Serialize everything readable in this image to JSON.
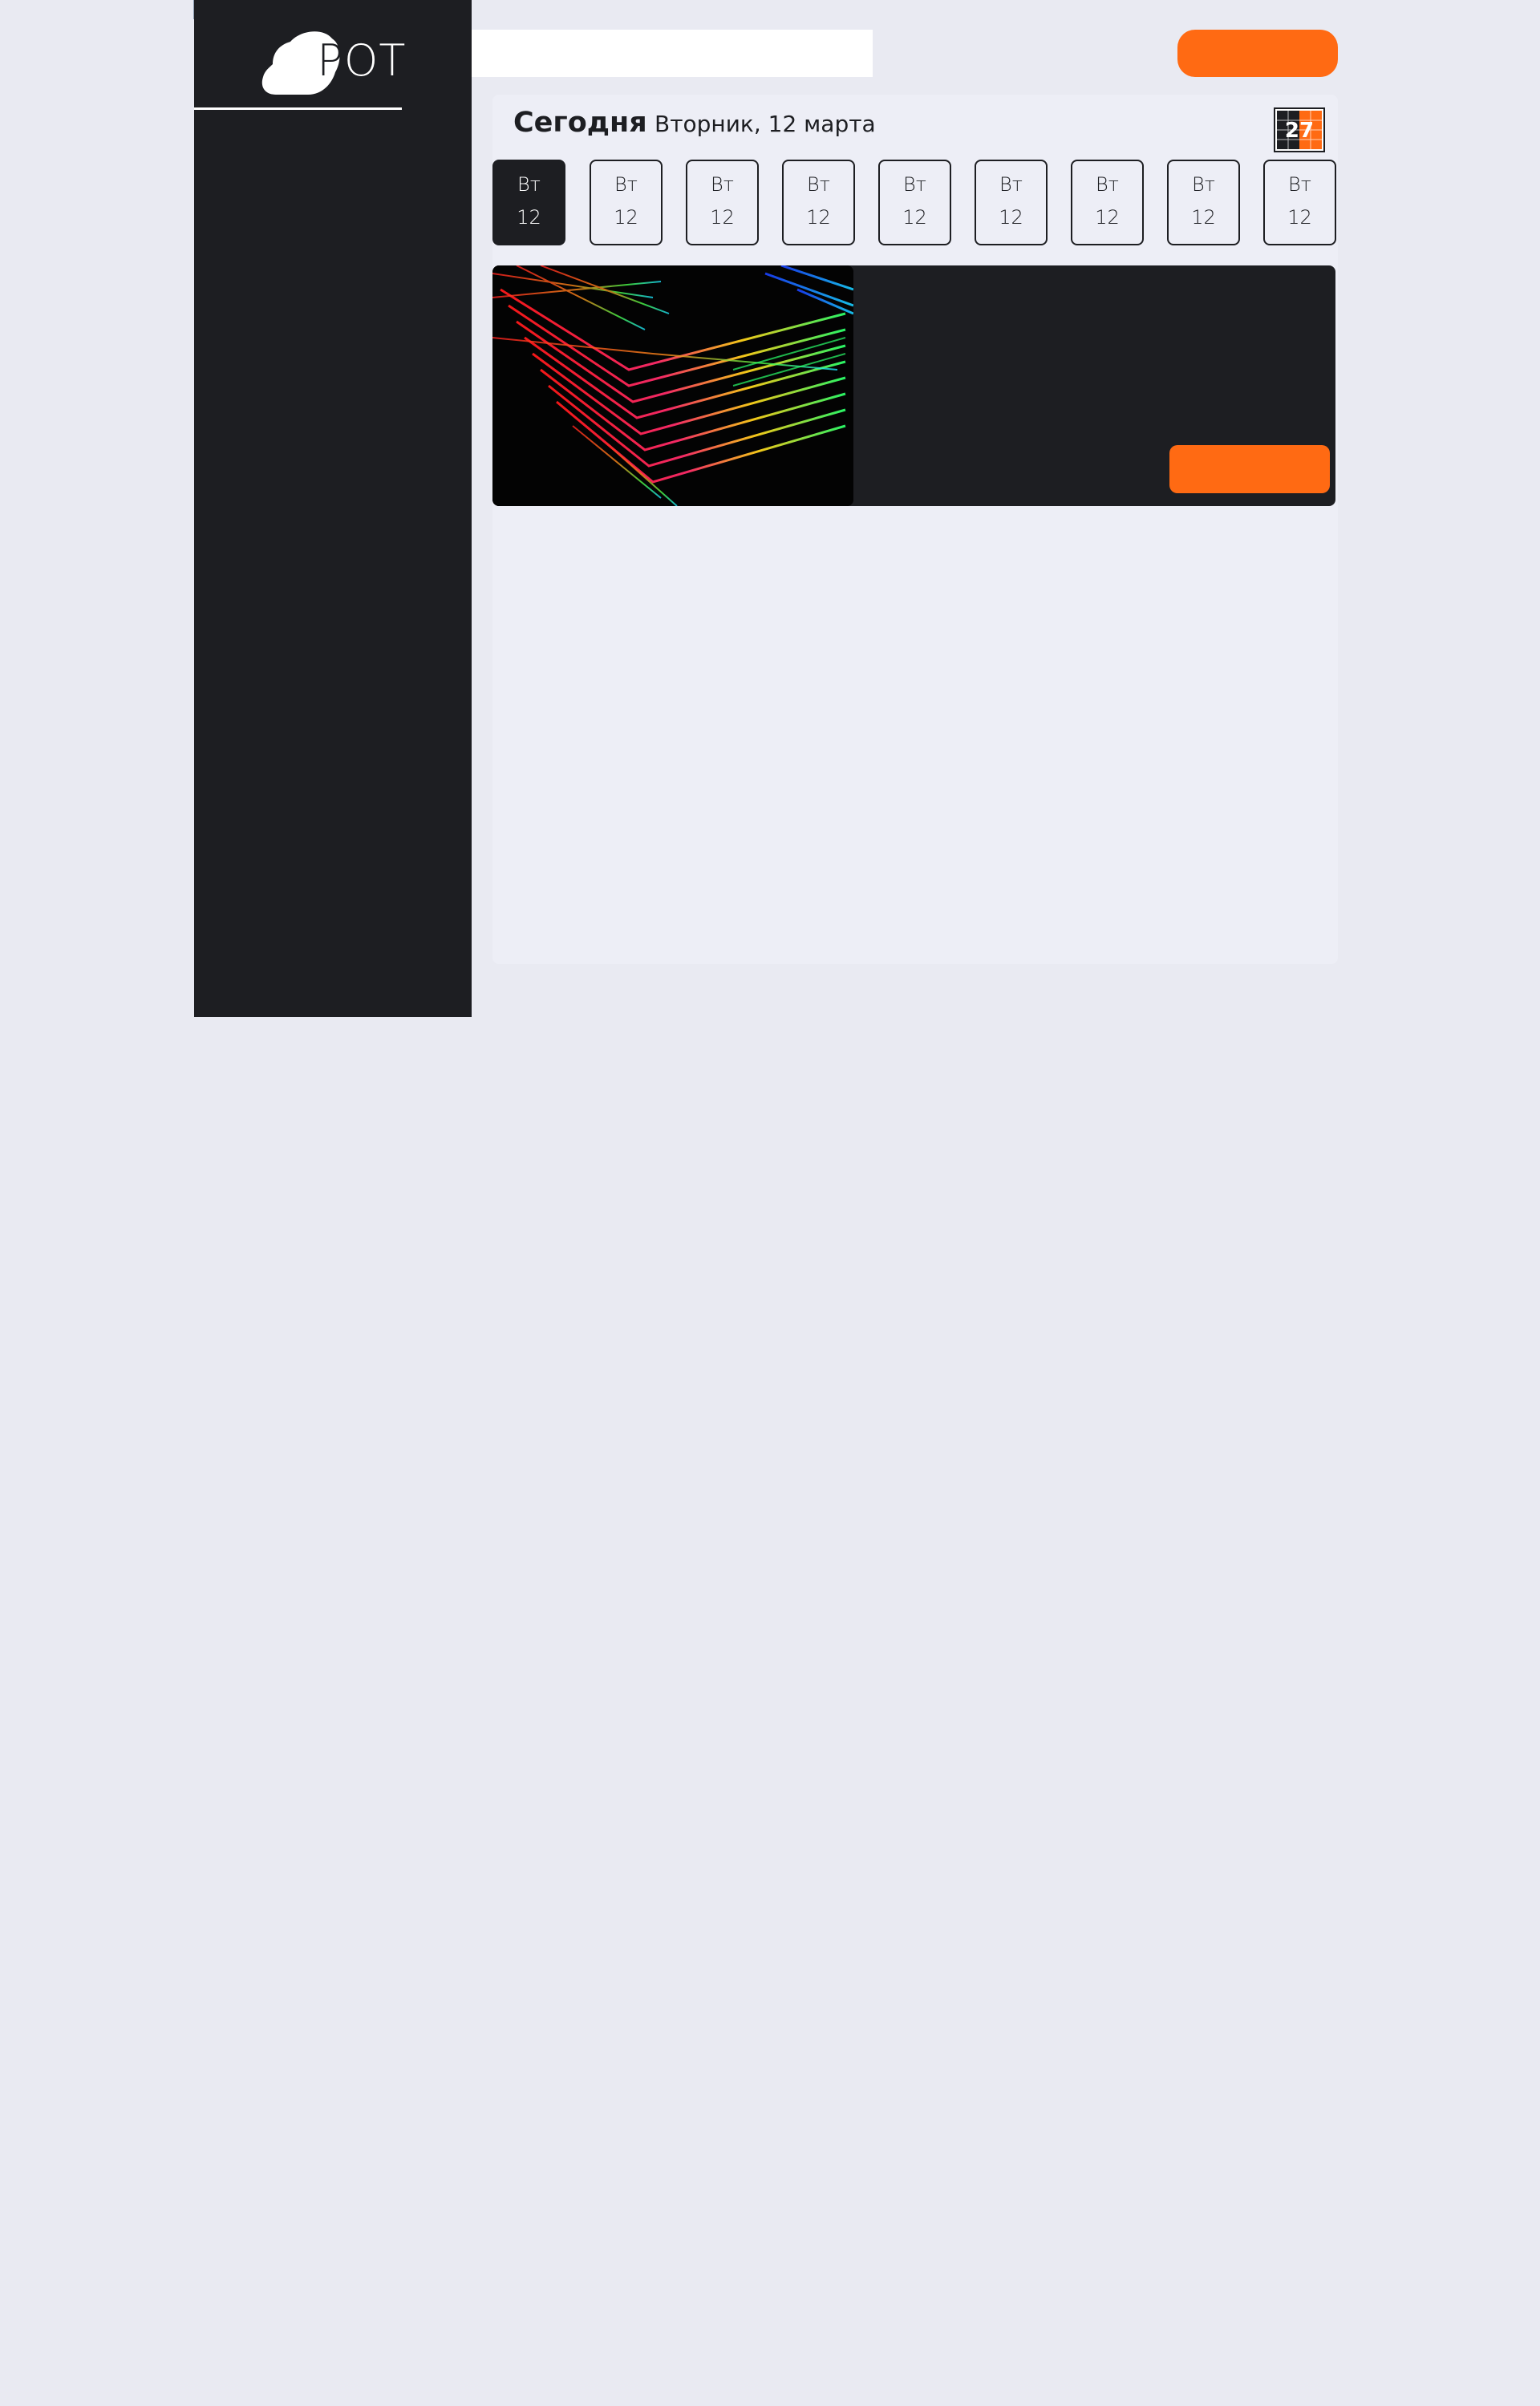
{
  "brand": {
    "logo_text_s": "S",
    "logo_text_p": "P",
    "logo_text_ot": "OT"
  },
  "header": {
    "search_value": "",
    "action_button_label": ""
  },
  "schedule": {
    "today_label": "Сегодня",
    "date_label": "Вторник, 12 марта",
    "calendar_icon_number": "27",
    "days": [
      {
        "weekday": "Вт",
        "day": "12",
        "active": true
      },
      {
        "weekday": "Вт",
        "day": "12",
        "active": false
      },
      {
        "weekday": "Вт",
        "day": "12",
        "active": false
      },
      {
        "weekday": "Вт",
        "day": "12",
        "active": false
      },
      {
        "weekday": "Вт",
        "day": "12",
        "active": false
      },
      {
        "weekday": "Вт",
        "day": "12",
        "active": false
      },
      {
        "weekday": "Вт",
        "day": "12",
        "active": false
      },
      {
        "weekday": "Вт",
        "day": "12",
        "active": false
      },
      {
        "weekday": "Вт",
        "day": "12",
        "active": false
      }
    ]
  },
  "event": {
    "image_icon": "neon-lines-image",
    "button_label": ""
  },
  "colors": {
    "accent": "#ff6a13",
    "dark": "#1d1e22",
    "background": "#e9eaf2",
    "panel": "#edeef6"
  }
}
